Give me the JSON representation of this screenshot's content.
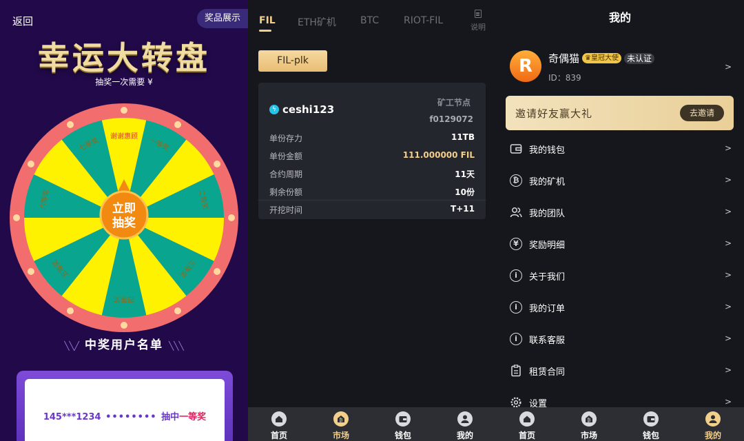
{
  "lottery": {
    "back_label": "返回",
    "prize_show_label": "奖品展示",
    "title": "幸运大转盘",
    "subtitle": "抽奖一次需要 ¥",
    "wheel_segments": [
      "谢谢惠顾",
      "一等奖",
      "",
      "二等奖",
      "",
      "三等奖",
      "",
      "四等奖",
      "",
      "五等奖",
      "",
      "六等奖",
      "",
      "七等奖"
    ],
    "spin_button_line1": "立即",
    "spin_button_line2": "抽奖",
    "winners_title": "中奖用户名单",
    "winner": {
      "phone": "145***1234",
      "dots": "••••••••",
      "text": "抽中",
      "prize": "一等奖"
    }
  },
  "market": {
    "tabs": [
      "FIL",
      "ETH矿机",
      "BTC",
      "RIOT-FIL"
    ],
    "help_label": "说明",
    "subtab": "FIL-plk",
    "card": {
      "name": "ceshi123",
      "node_label": "矿工节点",
      "node_id": "f0129072",
      "rows": [
        {
          "k": "单份存力",
          "v": "11TB"
        },
        {
          "k": "单份金额",
          "v": "111.000000 FIL"
        },
        {
          "k": "合约周期",
          "v": "11天"
        },
        {
          "k": "剩余份额",
          "v": "10份"
        },
        {
          "k": "开挖时间",
          "v": "T+11"
        }
      ]
    }
  },
  "mine": {
    "page_title": "我的",
    "avatar_letter": "R",
    "username": "奇偶猫",
    "vip_badge": "♛皇冠大使",
    "unverified_badge": "未认证",
    "uid": "ID：839",
    "invite_text": "邀请好友赢大礼",
    "invite_button": "去邀请",
    "arrow": ">",
    "menu": [
      {
        "label": "我的钱包",
        "icon": "wallet-icon"
      },
      {
        "label": "我的矿机",
        "icon": "miner-icon"
      },
      {
        "label": "我的团队",
        "icon": "team-icon"
      },
      {
        "label": "奖励明细",
        "icon": "reward-icon"
      },
      {
        "label": "关于我们",
        "icon": "info-icon"
      },
      {
        "label": "我的订单",
        "icon": "order-icon"
      },
      {
        "label": "联系客服",
        "icon": "service-icon"
      },
      {
        "label": "租赁合同",
        "icon": "contract-icon"
      },
      {
        "label": "设置",
        "icon": "settings-icon"
      }
    ]
  },
  "nav": [
    "首页",
    "市场",
    "钱包",
    "我的"
  ],
  "colors": {
    "accent": "#f3cf8c",
    "wheel_yellow": "#fff200",
    "wheel_teal": "#0aa58e",
    "wheel_rim": "#f26e6e"
  }
}
